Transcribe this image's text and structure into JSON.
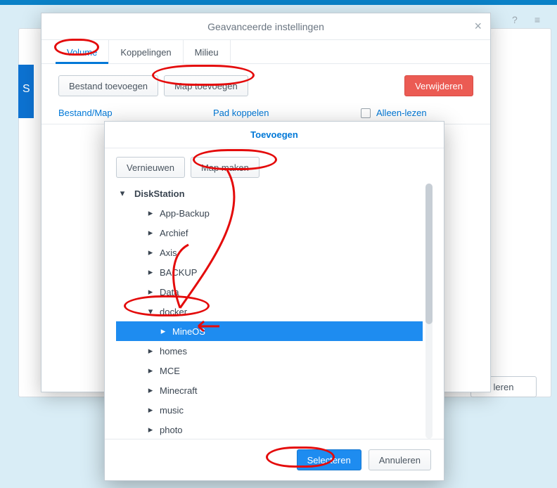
{
  "topbar": {
    "help_icon": "?",
    "menu_icon": "≡"
  },
  "bg": {
    "cancel": "leren",
    "side_letters": "S"
  },
  "modal1": {
    "title": "Geavanceerde instellingen",
    "close": "×",
    "tabs": {
      "volume": "Volume",
      "koppelingen": "Koppelingen",
      "milieu": "Milieu"
    },
    "toolbar": {
      "add_file": "Bestand toevoegen",
      "add_folder": "Map toevoegen",
      "delete": "Verwijderen"
    },
    "columns": {
      "file": "Bestand/Map",
      "path": "Pad koppelen",
      "readonly": "Alleen-lezen"
    }
  },
  "modal2": {
    "title": "Toevoegen",
    "toolbar": {
      "refresh": "Vernieuwen",
      "mkdir": "Map maken"
    },
    "root": "DiskStation",
    "items": [
      {
        "label": "App-Backup",
        "level": 2,
        "open": false
      },
      {
        "label": "Archief",
        "level": 2,
        "open": false
      },
      {
        "label": "Axis",
        "level": 2,
        "open": false
      },
      {
        "label": "BACKUP",
        "level": 2,
        "open": false
      },
      {
        "label": "Data",
        "level": 2,
        "open": false
      },
      {
        "label": "docker",
        "level": 2,
        "open": true
      },
      {
        "label": "MineOS",
        "level": 3,
        "open": false,
        "selected": true
      },
      {
        "label": "homes",
        "level": 2,
        "open": false
      },
      {
        "label": "MCE",
        "level": 2,
        "open": false
      },
      {
        "label": "Minecraft",
        "level": 2,
        "open": false
      },
      {
        "label": "music",
        "level": 2,
        "open": false
      },
      {
        "label": "photo",
        "level": 2,
        "open": false
      }
    ],
    "footer": {
      "select": "Selecteren",
      "cancel": "Annuleren"
    }
  }
}
